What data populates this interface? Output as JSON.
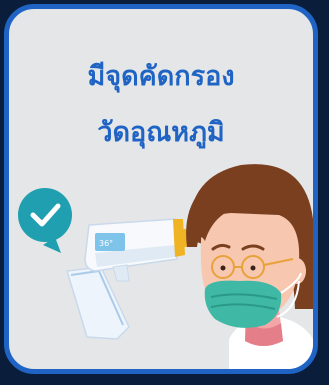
{
  "poster": {
    "title_line1": "มีจุดคัดกรอง",
    "title_line2": "วัดอุณหภูมิ",
    "thermometer_reading": "36°"
  },
  "colors": {
    "frame_border": "#1f64c4",
    "background": "#e5e6e7",
    "title_text": "#1f64c4",
    "check_badge": "#1f9fb0",
    "mask": "#3fb8a5",
    "hair": "#7a3f1f",
    "thermometer_accent": "#f0b323"
  },
  "icons": [
    "check-icon",
    "thermometer-gun-icon",
    "person-with-mask-illustration"
  ]
}
